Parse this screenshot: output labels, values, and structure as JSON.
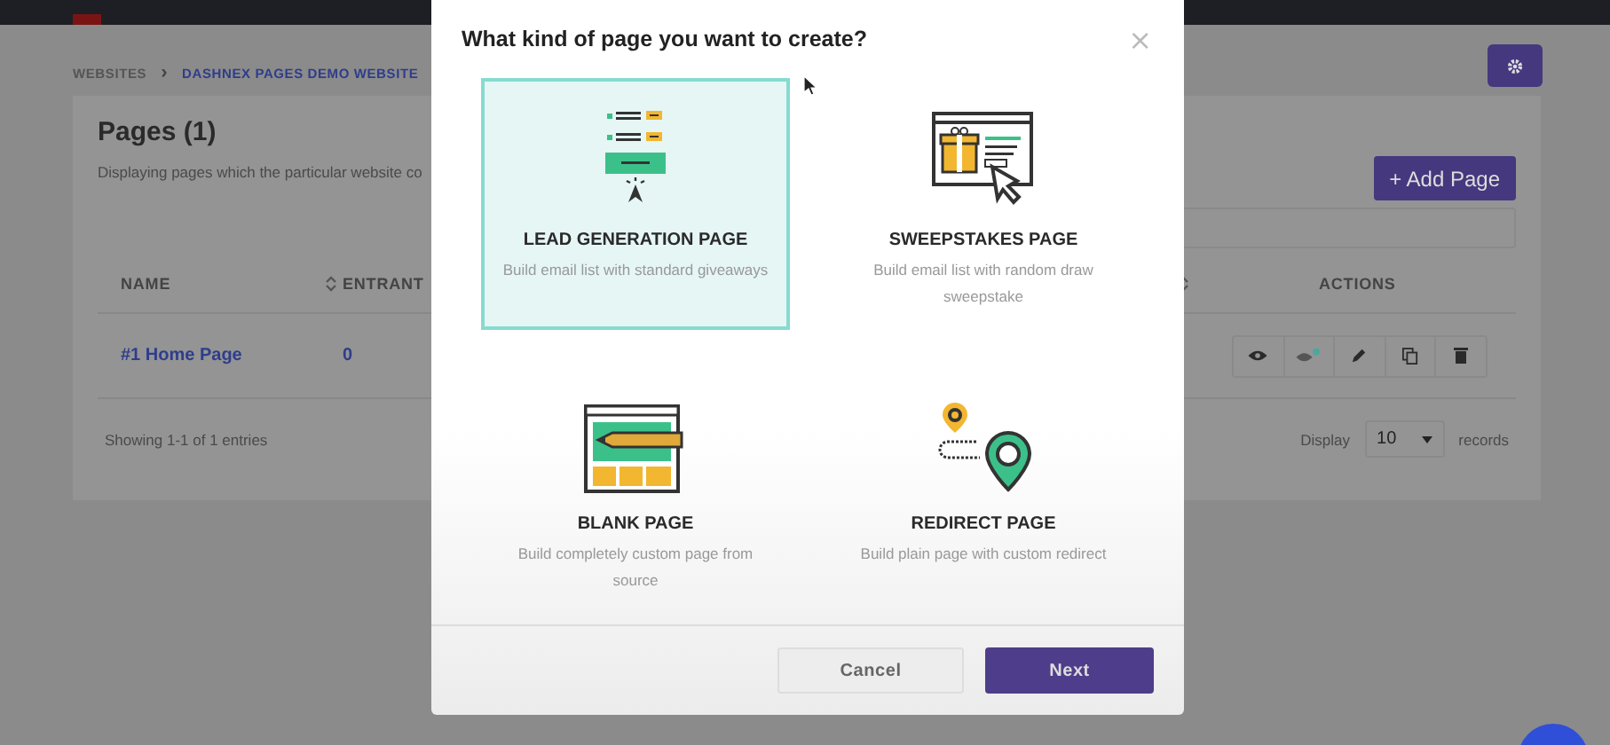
{
  "breadcrumb_separator": "›",
  "breadcrumb": [
    {
      "label": "WEBSITES",
      "current": false
    },
    {
      "label": "DASHNEX PAGES DEMO WEBSITE",
      "current": true
    }
  ],
  "panel": {
    "title": "Pages (1)",
    "description": "Displaying pages which the particular website co",
    "add_button": "+ Add Page"
  },
  "table": {
    "columns": [
      {
        "label": "NAME",
        "sortable": true
      },
      {
        "label": "ENTRANT"
      },
      {
        "sortable": true
      },
      {
        "label": "ACTIONS"
      }
    ],
    "rows": [
      {
        "name": "#1 Home Page",
        "entrants": "0",
        "actions": [
          {
            "kind": "view"
          },
          {
            "kind": "live"
          },
          {
            "kind": "edit"
          },
          {
            "kind": "copy"
          },
          {
            "kind": "delete"
          }
        ]
      }
    ]
  },
  "footer": {
    "summary": "Showing 1-1 of 1 entries",
    "display_label": "Display",
    "page_size": "10",
    "records_label": "records"
  },
  "modal": {
    "title": "What kind of page you want to create?",
    "close": "×",
    "options": [
      {
        "kind": "lead",
        "title": "LEAD GENERATION PAGE",
        "description": "Build email list with standard giveaways",
        "selected": true
      },
      {
        "kind": "sweepstakes",
        "title": "SWEEPSTAKES PAGE",
        "description": "Build email list with random draw sweepstake",
        "selected": false
      },
      {
        "kind": "blank",
        "title": "BLANK PAGE",
        "description": "Build completely custom page from source",
        "selected": false
      },
      {
        "kind": "redirect",
        "title": "REDIRECT PAGE",
        "description": "Build plain page with custom redirect",
        "selected": false
      }
    ],
    "buttons": [
      {
        "kind": "secondary",
        "label": "Cancel"
      },
      {
        "kind": "primary",
        "label": "Next"
      }
    ]
  }
}
